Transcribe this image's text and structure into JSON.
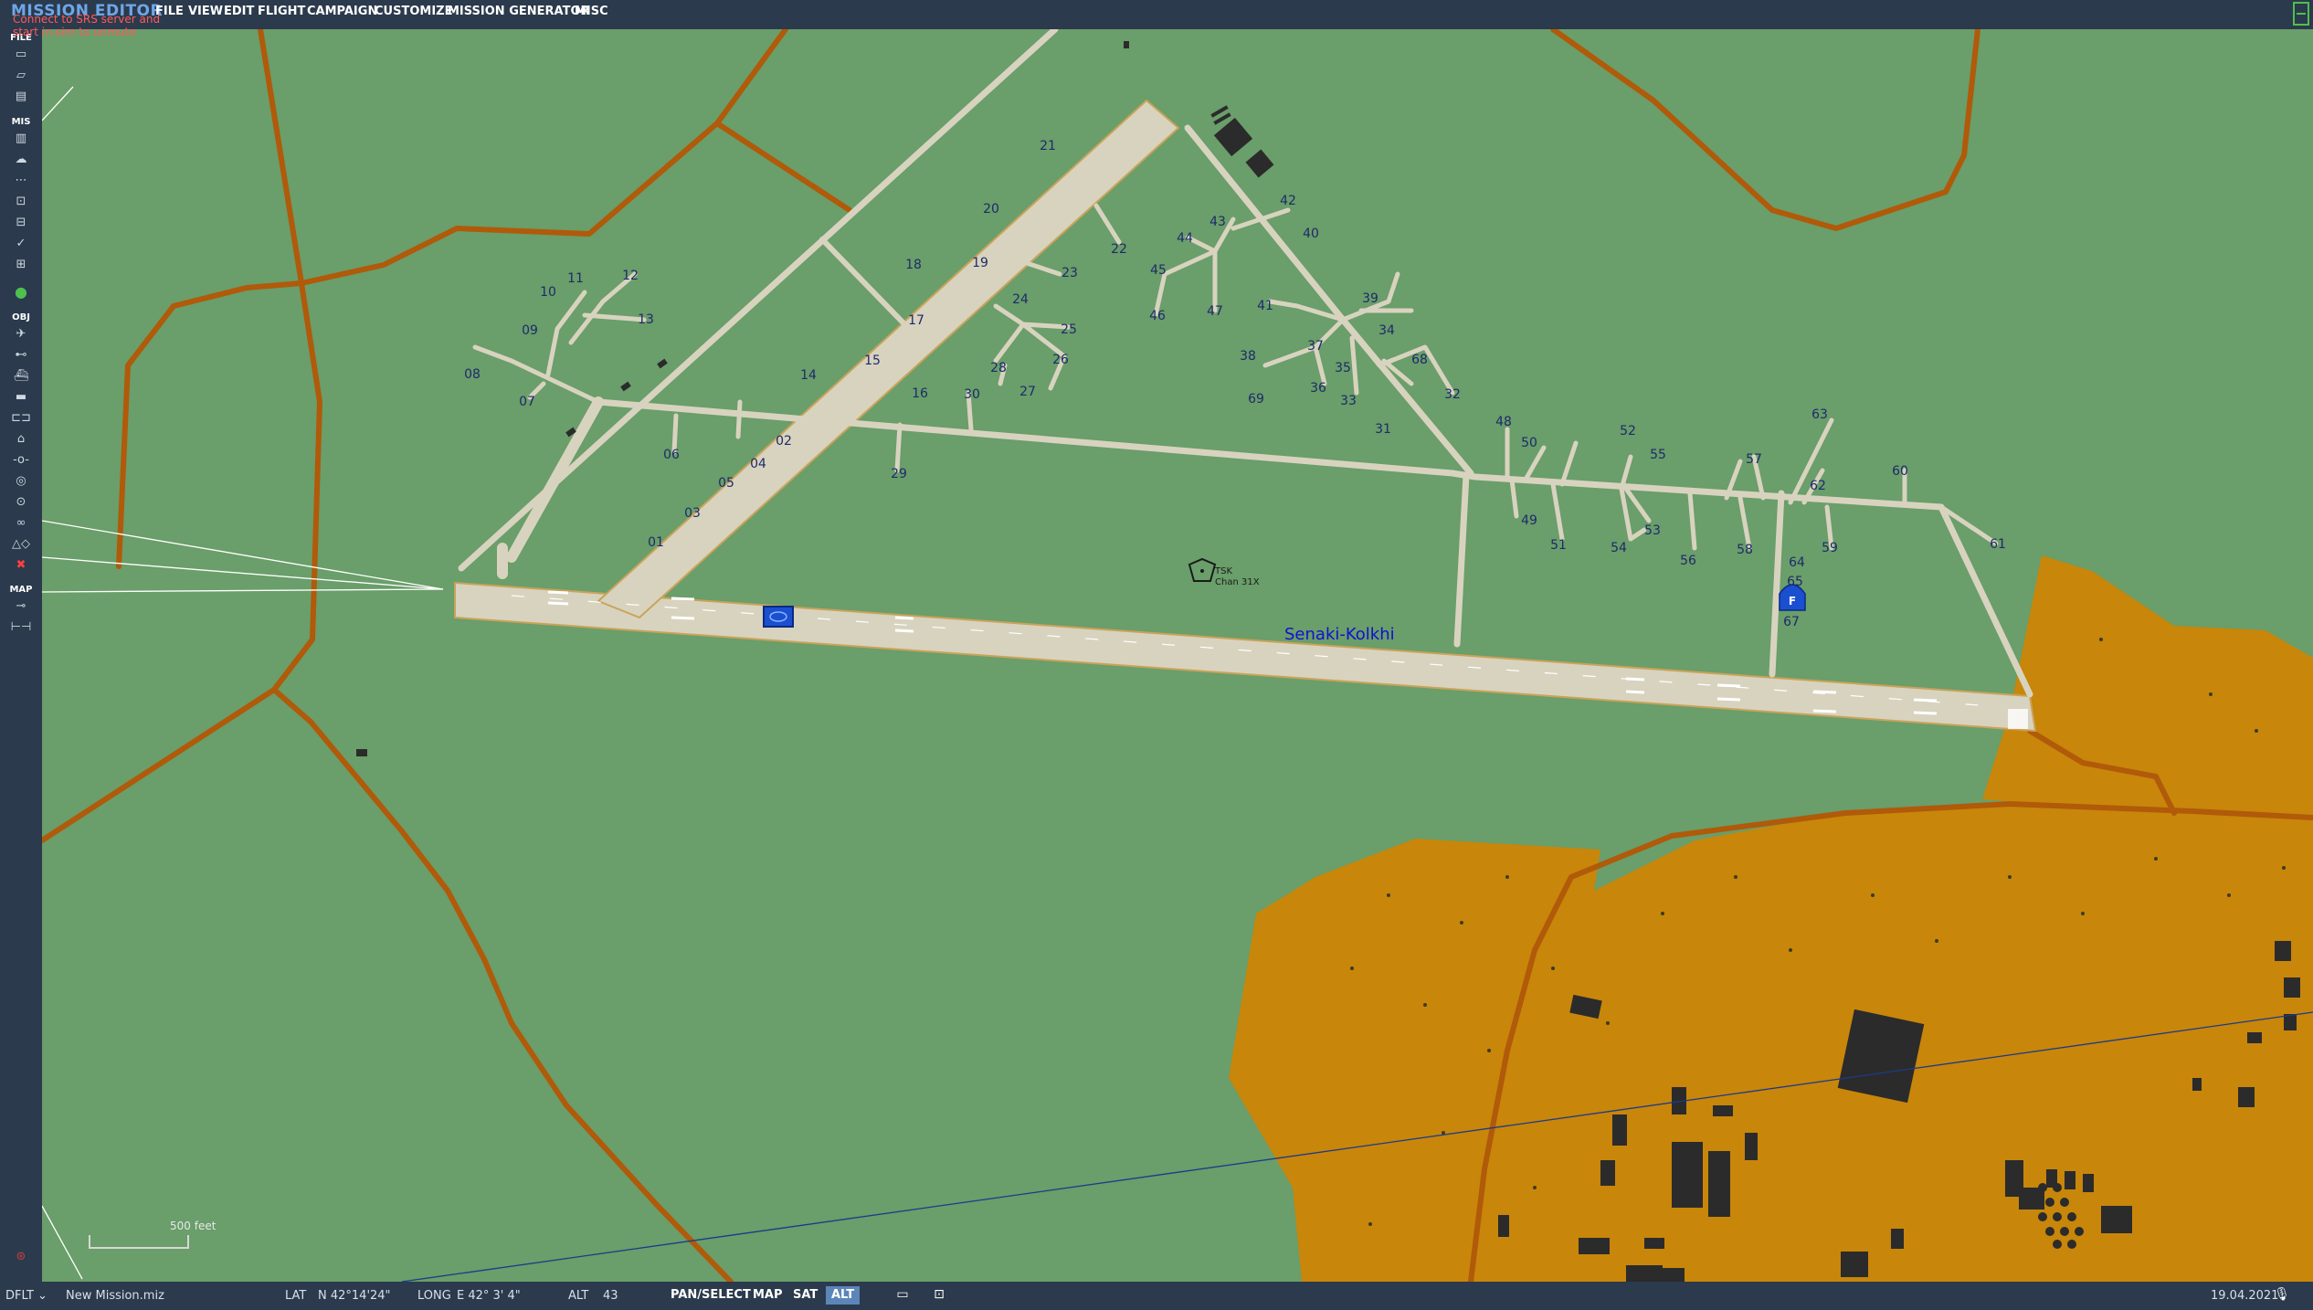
{
  "app": {
    "title": "MISSION EDITOR",
    "warning_line1": "Connect to SRS server and",
    "warning_line2": "start in-sim to unmute"
  },
  "menu": [
    {
      "label": "FILE"
    },
    {
      "label": "VIEW"
    },
    {
      "label": "EDIT"
    },
    {
      "label": "FLIGHT"
    },
    {
      "label": "CAMPAIGN"
    },
    {
      "label": "CUSTOMIZE"
    },
    {
      "label": "MISSION GENERATOR"
    },
    {
      "label": "MISC"
    }
  ],
  "sidebar": {
    "sections": [
      {
        "label": "FILE"
      },
      {
        "label": "MIS"
      },
      {
        "label": "OBJ"
      },
      {
        "label": "MAP"
      }
    ],
    "file_tools": [
      "new-file-icon",
      "open-file-icon",
      "save-file-icon"
    ],
    "mis_tools": [
      "trash-icon",
      "weather-icon",
      "route-icon",
      "zone-icon",
      "briefing-icon",
      "check-icon",
      "goals-icon",
      "triggers-icon"
    ],
    "obj_tools": [
      "plane-icon",
      "helicopter-icon",
      "ship-icon",
      "vehicle-icon",
      "train-icon",
      "static-icon",
      "waypoint-icon",
      "target-icon",
      "ring-icon",
      "group-icon",
      "shapes-icon",
      "delete-icon"
    ],
    "map_tools": [
      "key-icon",
      "ruler-icon"
    ]
  },
  "map": {
    "airbase_name": "Senaki-Kolkhi",
    "tacan_line1": "TSK",
    "tacan_line2": "Chan 31X",
    "farp_label": "F",
    "scale_label": "500 feet",
    "colors": {
      "grass": "#6a9e6a",
      "urban": "#c8860a",
      "road": "#b05a0a",
      "tarmac": "#d8d3bf",
      "building": "#2b2b2b",
      "label": "#1e2a6a",
      "airbase_name": "#1010d0",
      "blue_unit": "#1a4fd0"
    },
    "parking_spots": [
      "01",
      "02",
      "03",
      "04",
      "05",
      "06",
      "07",
      "08",
      "09",
      "10",
      "11",
      "12",
      "13",
      "14",
      "15",
      "16",
      "17",
      "18",
      "19",
      "20",
      "21",
      "22",
      "23",
      "24",
      "25",
      "26",
      "27",
      "28",
      "29",
      "30",
      "31",
      "32",
      "33",
      "34",
      "35",
      "36",
      "37",
      "38",
      "39",
      "40",
      "41",
      "42",
      "43",
      "44",
      "45",
      "46",
      "47",
      "48",
      "49",
      "50",
      "51",
      "52",
      "53",
      "54",
      "55",
      "56",
      "57",
      "58",
      "59",
      "60",
      "61",
      "62",
      "63",
      "64",
      "65",
      "67",
      "68",
      "69"
    ]
  },
  "status": {
    "profile": "DFLT",
    "mission_file": "New Mission.miz",
    "lat_label": "LAT",
    "lat_value": "N 42°14'24\"",
    "long_label": "LONG",
    "long_value": "E 42° 3' 4\"",
    "alt_label": "ALT",
    "alt_value": "43",
    "pan_select": "PAN/SELECT",
    "map_btn": "MAP",
    "sat_btn": "SAT",
    "alt_btn": "ALT",
    "date": "19.04.2021"
  }
}
